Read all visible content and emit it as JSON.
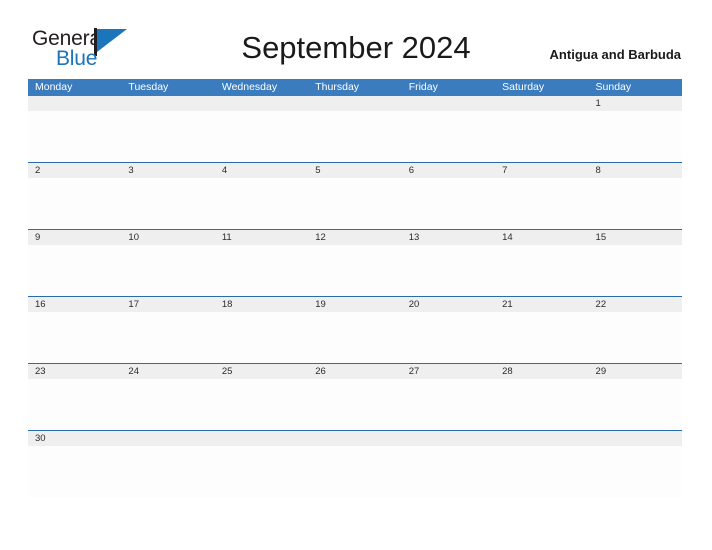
{
  "brand": {
    "word_one": "General",
    "word_two": "Blue",
    "mark": "sail-triangle",
    "color_dark": "#231f20",
    "color_blue": "#1b75bb"
  },
  "header": {
    "title": "September 2024",
    "country": "Antigua and Barbuda"
  },
  "calendar": {
    "month": "September",
    "year": "2024",
    "first_day_of_week": "Monday",
    "header_bg": "#3b7cbf",
    "date_band_bg": "#efefef",
    "rule_color": "#2a6cab",
    "weekdays": [
      "Monday",
      "Tuesday",
      "Wednesday",
      "Thursday",
      "Friday",
      "Saturday",
      "Sunday"
    ],
    "weeks": [
      {
        "days": [
          {
            "num": ""
          },
          {
            "num": ""
          },
          {
            "num": ""
          },
          {
            "num": ""
          },
          {
            "num": ""
          },
          {
            "num": ""
          },
          {
            "num": "1"
          }
        ]
      },
      {
        "days": [
          {
            "num": "2"
          },
          {
            "num": "3"
          },
          {
            "num": "4"
          },
          {
            "num": "5"
          },
          {
            "num": "6"
          },
          {
            "num": "7"
          },
          {
            "num": "8"
          }
        ]
      },
      {
        "days": [
          {
            "num": "9"
          },
          {
            "num": "10"
          },
          {
            "num": "11"
          },
          {
            "num": "12"
          },
          {
            "num": "13"
          },
          {
            "num": "14"
          },
          {
            "num": "15"
          }
        ]
      },
      {
        "days": [
          {
            "num": "16"
          },
          {
            "num": "17"
          },
          {
            "num": "18"
          },
          {
            "num": "19"
          },
          {
            "num": "20"
          },
          {
            "num": "21"
          },
          {
            "num": "22"
          }
        ]
      },
      {
        "days": [
          {
            "num": "23"
          },
          {
            "num": "24"
          },
          {
            "num": "25"
          },
          {
            "num": "26"
          },
          {
            "num": "27"
          },
          {
            "num": "28"
          },
          {
            "num": "29"
          }
        ]
      },
      {
        "days": [
          {
            "num": "30"
          },
          {
            "num": ""
          },
          {
            "num": ""
          },
          {
            "num": ""
          },
          {
            "num": ""
          },
          {
            "num": ""
          },
          {
            "num": ""
          }
        ]
      }
    ]
  }
}
